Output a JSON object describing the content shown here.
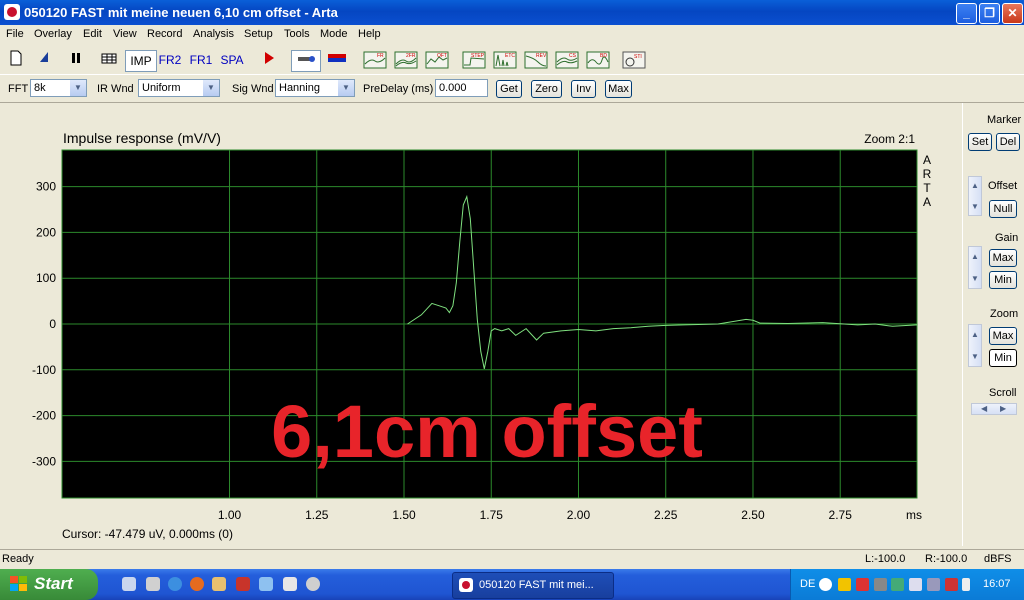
{
  "window": {
    "title": "050120 FAST mit meine neuen 6,10 cm offset - Arta"
  },
  "menu": [
    "File",
    "Overlay",
    "Edit",
    "View",
    "Record",
    "Analysis",
    "Setup",
    "Tools",
    "Mode",
    "Help"
  ],
  "toolbar": {
    "imp": "IMP",
    "fr2": "FR2",
    "fr1": "FR1",
    "spa": "SPA",
    "mini_labels": [
      "FR",
      "2FR",
      "OFT",
      "STEP",
      "ETC",
      "REV",
      "CS",
      "BD",
      "STI"
    ]
  },
  "options": {
    "fft_label": "FFT",
    "fft_value": "8k",
    "irwnd_label": "IR Wnd",
    "irwnd_value": "Uniform",
    "sigwnd_label": "Sig Wnd",
    "sigwnd_value": "Hanning",
    "predelay_label": "PreDelay (ms)",
    "predelay_value": "0.000",
    "get": "Get",
    "zero": "Zero",
    "inv": "Inv",
    "max": "Max"
  },
  "right_panel": {
    "marker": "Marker",
    "set": "Set",
    "del": "Del",
    "offset": "Offset",
    "null": "Null",
    "gain": "Gain",
    "gain_max": "Max",
    "gain_min": "Min",
    "zoom": "Zoom",
    "zoom_max": "Max",
    "zoom_min": "Min",
    "scroll": "Scroll"
  },
  "chart_data": {
    "type": "line",
    "title": "Impulse response (mV/V)",
    "zoom_text": "Zoom 2:1",
    "side_label": [
      "A",
      "R",
      "T",
      "A"
    ],
    "xlabel": "ms",
    "xlim": [
      0.52,
      2.97
    ],
    "ylim": [
      -380,
      380
    ],
    "xticks": [
      1.0,
      1.25,
      1.5,
      1.75,
      2.0,
      2.25,
      2.5,
      2.75
    ],
    "xtick_labels": [
      "1.00",
      "1.25",
      "1.50",
      "1.75",
      "2.00",
      "2.25",
      "2.50",
      "2.75"
    ],
    "yticks": [
      300,
      200,
      100,
      0,
      -100,
      -200,
      -300
    ],
    "ytick_labels": [
      "300",
      "200",
      "100",
      "0",
      "-100",
      "-200",
      "-300"
    ],
    "grid": true,
    "line_color": "#7fe07f",
    "series": [
      {
        "x": [
          1.51,
          1.55,
          1.58,
          1.6,
          1.62,
          1.63,
          1.64,
          1.65,
          1.66,
          1.67,
          1.68,
          1.69,
          1.7,
          1.71,
          1.72,
          1.73,
          1.74,
          1.75,
          1.76,
          1.78,
          1.8,
          1.82,
          1.85,
          1.88,
          1.9,
          1.95,
          2.0,
          2.05,
          2.1,
          2.15,
          2.2,
          2.25,
          2.3,
          2.4,
          2.48,
          2.5,
          2.52,
          2.6,
          2.7,
          2.8,
          2.85,
          2.9,
          2.97
        ],
        "y": [
          0,
          20,
          45,
          40,
          35,
          25,
          40,
          90,
          180,
          260,
          278,
          230,
          120,
          10,
          -60,
          -98,
          -60,
          -15,
          -10,
          -15,
          -10,
          -25,
          -10,
          -35,
          -20,
          -15,
          -12,
          -15,
          -10,
          -8,
          -5,
          -3,
          -2,
          0,
          10,
          8,
          2,
          1,
          3,
          -2,
          0,
          -5,
          -2
        ]
      }
    ],
    "cursor_text": "Cursor: -47.479 uV, 0.000ms (0)",
    "overlay_text": "6,1cm offset",
    "overlay_color": "#e8242a"
  },
  "status": {
    "ready": "Ready",
    "l": "L:-100.0",
    "r": "R:-100.0",
    "dbfs": "dBFS"
  },
  "taskbar": {
    "start": "Start",
    "task": "050120 FAST mit mei...",
    "lang": "DE",
    "time": "16:07"
  }
}
